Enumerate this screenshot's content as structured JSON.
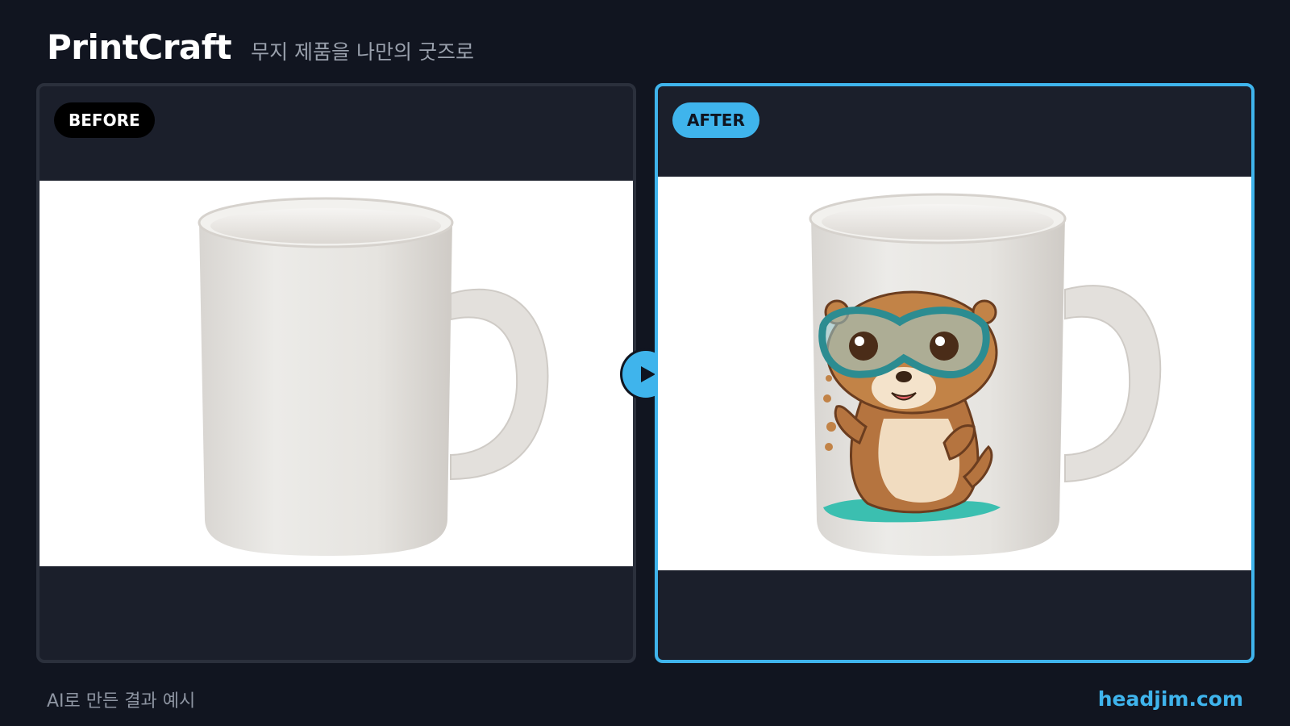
{
  "header": {
    "brand": "PrintCraft",
    "tagline": "무지 제품을 나만의 굿즈로"
  },
  "before_panel": {
    "badge": "BEFORE",
    "image": "plain-white-mug"
  },
  "after_panel": {
    "badge": "AFTER",
    "image": "white-mug-with-otter-print"
  },
  "compare_button": {
    "icon": "play-arrow-icon"
  },
  "footer": {
    "note": "AI로 만든 결과 예시",
    "site": "headjim.com"
  },
  "colors": {
    "background": "#111520",
    "panel": "#1b1f2b",
    "accent": "#3fb4ec",
    "before_badge": "#000000"
  }
}
